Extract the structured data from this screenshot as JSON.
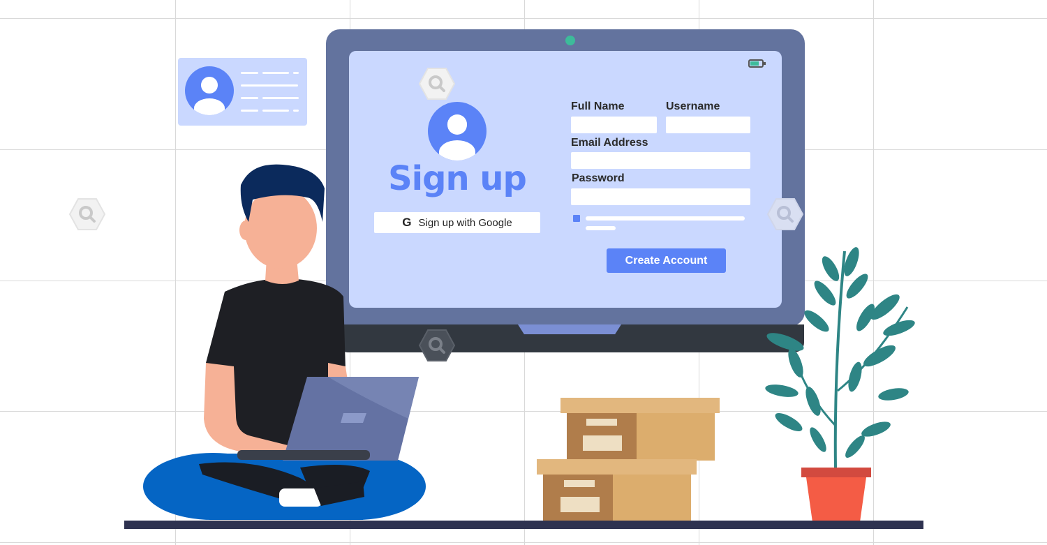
{
  "signup": {
    "title": "Sign up",
    "google_button": "Sign up with Google",
    "google_glyph": "G"
  },
  "form": {
    "full_name_label": "Full Name",
    "username_label": "Username",
    "email_label": "Email Address",
    "password_label": "Password",
    "submit_label": "Create Account"
  },
  "colors": {
    "accent": "#5b83f7",
    "screen": "#cad8ff",
    "monitor": "#63739e",
    "webcam": "#3dbb9a",
    "plant_leaf": "#2e8585",
    "pot": "#f45c45",
    "box": "#dcad6d"
  },
  "icons": [
    "battery-icon",
    "search-hexagon-icon",
    "user-avatar-icon",
    "google-icon"
  ]
}
